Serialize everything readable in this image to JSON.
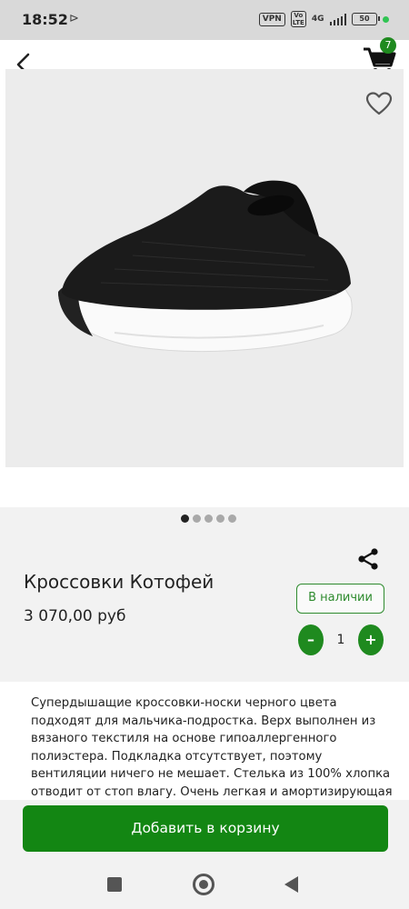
{
  "status_bar": {
    "time": "18:52",
    "cast_icon": "cast-play-icon",
    "vpn": "VPN",
    "volte": "Vo LTE",
    "network": "4G",
    "battery": "50",
    "battery_dot_color": "#30c453"
  },
  "header": {
    "back_icon": "back-arrow-icon",
    "cart_icon": "cart-icon",
    "cart_count": "7",
    "favorite_icon": "heart-outline-icon"
  },
  "gallery": {
    "image": "black knit slip-on sneaker with white sole",
    "total_dots": 5,
    "active_dot": 1
  },
  "product": {
    "title": "Кроссовки Котофей",
    "price": "3 070,00 руб",
    "stock_status": "В наличии",
    "share_icon": "share-icon",
    "quantity": "1",
    "minus_label": "–",
    "plus_label": "+",
    "description": "Супердышащие кроссовки-носки черного цвета подходят для мальчика-подростка. Верх выполнен из вязаного текстиля на основе гипоаллергенного полиэстера. Подкладка отсутствует, поэтому вентиляции ничего не мешает. Стелька из 100% хлопка отводит от стоп влагу. Очень легкая и амортизирующая подошва из"
  },
  "actions": {
    "add_to_cart": "Добавить в корзину"
  },
  "colors": {
    "accent": "#1f8a1f",
    "button": "#138613"
  },
  "system_nav": {
    "recents_icon": "square-recents-icon",
    "home_icon": "circle-home-icon",
    "back_icon": "triangle-back-icon"
  }
}
